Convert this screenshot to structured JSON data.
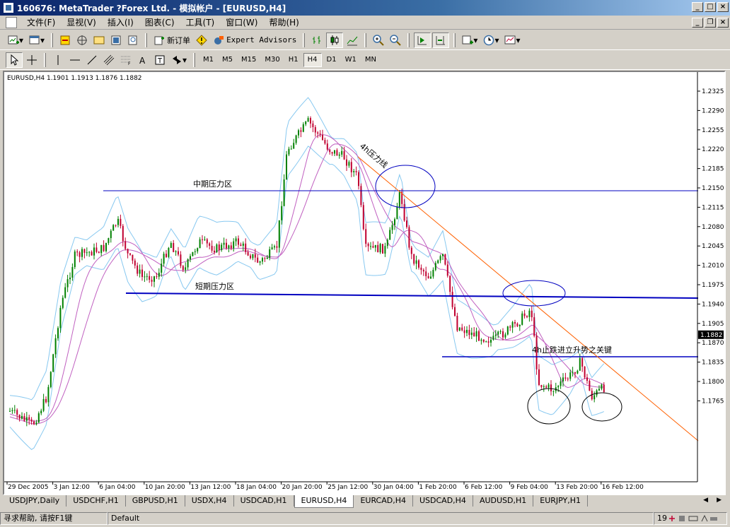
{
  "window": {
    "title": "160676: MetaTrader ?Forex Ltd. - 模拟帐户 - [EURUSD,H4]"
  },
  "menu": {
    "items": [
      "文件(F)",
      "显视(V)",
      "插入(I)",
      "图表(C)",
      "工具(T)",
      "窗口(W)",
      "帮助(H)"
    ]
  },
  "toolbar": {
    "new_order_label": "新订单",
    "expert_advisors_label": "Expert Advisors"
  },
  "timeframes": [
    "M1",
    "M5",
    "M15",
    "M30",
    "H1",
    "H4",
    "D1",
    "W1",
    "MN"
  ],
  "active_timeframe": "H4",
  "chart": {
    "header": "EURUSD,H4  1.1901 1.1913 1.1876 1.1882",
    "current_price": "1.1882",
    "price_ticks": [
      "1.2325",
      "1.2290",
      "1.2255",
      "1.2220",
      "1.2185",
      "1.2150",
      "1.2115",
      "1.2080",
      "1.2045",
      "1.2010",
      "1.1975",
      "1.1940",
      "1.1905",
      "1.1870",
      "1.1835",
      "1.1800",
      "1.1765"
    ],
    "time_ticks": [
      "29 Dec 2005",
      "3 Jan 12:00",
      "6 Jan 04:00",
      "10 Jan 20:00",
      "13 Jan 12:00",
      "18 Jan 04:00",
      "20 Jan 20:00",
      "25 Jan 12:00",
      "30 Jan 04:00",
      "1 Feb 20:00",
      "6 Feb 12:00",
      "9 Feb 04:00",
      "13 Feb 20:00",
      "16 Feb 12:00"
    ],
    "annotations": {
      "mid_resistance": "中期压力区",
      "short_resistance": "短期压力区",
      "h4_resistance_line": "4h压力线",
      "key_level": "4h止跌进立升势之关键"
    },
    "colors": {
      "bull": "#008000",
      "bear": "#c00030",
      "bands": "#87c8f0",
      "ma": "#c060c0",
      "hline": "#0000c0",
      "trend": "#ff6000"
    }
  },
  "tabs": [
    "USDJPY,Daily",
    "USDCHF,H1",
    "GBPUSD,H1",
    "USDX,H4",
    "USDCAD,H1",
    "EURUSD,H4",
    "EURCAD,H4",
    "USDCAD,H4",
    "AUDUSD,H1",
    "EURJPY,H1"
  ],
  "active_tab": "EURUSD,H4",
  "status": {
    "help": "寻求帮助, 请按F1键",
    "profile": "Default",
    "connection": "19"
  }
}
